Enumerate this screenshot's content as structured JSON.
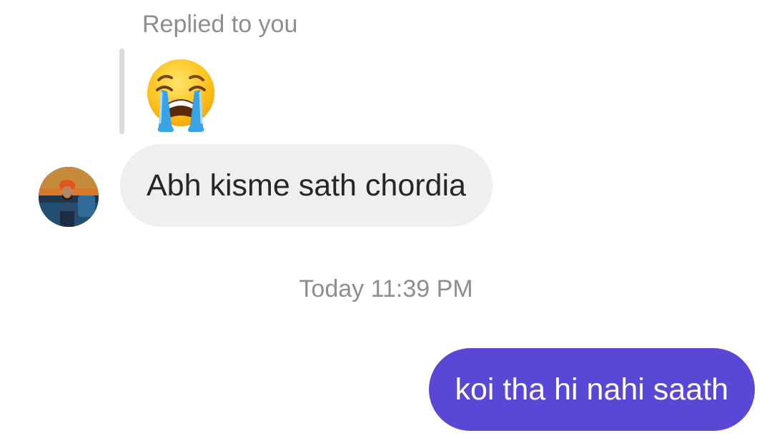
{
  "reply": {
    "label": "Replied to you",
    "quoted_icon": "loudly-crying-face-emoji"
  },
  "incoming": {
    "avatar_icon": "user-avatar",
    "text": "Abh kisme sath chordia"
  },
  "separator": {
    "timestamp": "Today 11:39 PM"
  },
  "outgoing": {
    "text": "koi tha hi nahi saath"
  },
  "colors": {
    "incoming_bubble": "#efefef",
    "outgoing_bubble": "#5b47d6",
    "meta_text": "#8e8e8e"
  }
}
